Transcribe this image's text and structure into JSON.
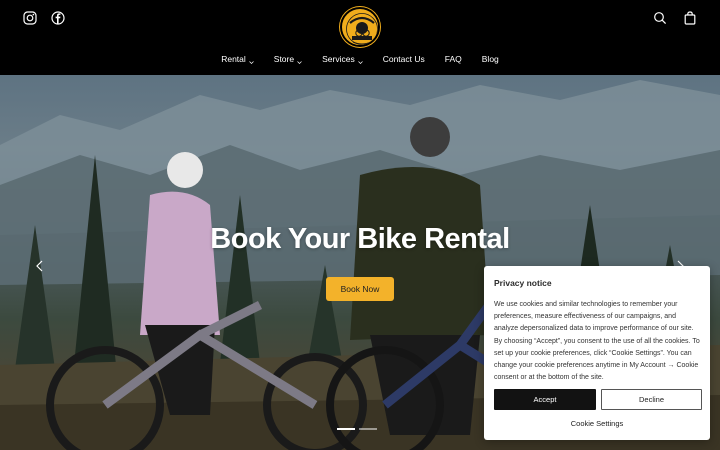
{
  "header": {
    "social_icons": [
      "instagram-icon",
      "facebook-icon"
    ],
    "utility_icons": [
      "search-icon",
      "shopping-bag-icon"
    ],
    "logo_text_top": "BEAR STREET",
    "logo_text_bottom": "OUTFITTERS",
    "nav": [
      {
        "label": "Rental",
        "has_dropdown": true
      },
      {
        "label": "Store",
        "has_dropdown": true
      },
      {
        "label": "Services",
        "has_dropdown": true
      },
      {
        "label": "Contact Us",
        "has_dropdown": false
      },
      {
        "label": "FAQ",
        "has_dropdown": false
      },
      {
        "label": "Blog",
        "has_dropdown": false
      }
    ]
  },
  "hero": {
    "title": "Book Your Bike Rental",
    "cta_label": "Book Now",
    "slide_count": 2,
    "active_slide": 1
  },
  "cookie": {
    "title": "Privacy notice",
    "body": "We use cookies and similar technologies to remember your preferences, measure effectiveness of our campaigns, and analyze depersonalized data to improve performance of our site. By choosing “Accept”, you consent to the use of all the cookies. To set up your cookie preferences, click “Cookie Settings”. You can change your cookie preferences anytime in My Account → Cookie consent or at the bottom of the site.",
    "accept_label": "Accept",
    "decline_label": "Decline",
    "settings_label": "Cookie Settings"
  },
  "colors": {
    "accent": "#f3b22a",
    "header_bg": "#000000",
    "accept_bg": "#121212"
  }
}
